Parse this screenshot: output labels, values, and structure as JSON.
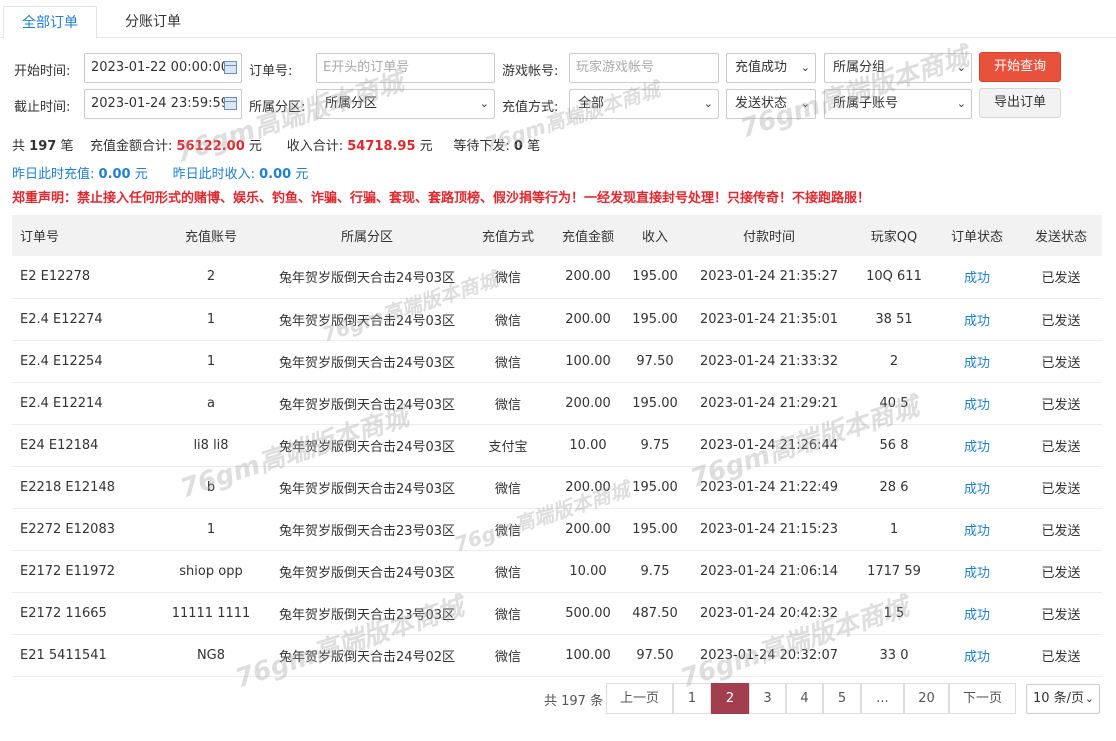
{
  "tabs": [
    {
      "label": "全部订单"
    },
    {
      "label": "分账订单"
    }
  ],
  "filters": {
    "start_time": {
      "label": "开始时间:",
      "value": "2023-01-22 00:00:00"
    },
    "end_time": {
      "label": "截止时间:",
      "value": "2023-01-24 23:59:59"
    },
    "order_no": {
      "label": "订单号:",
      "placeholder": "E开头的订单号"
    },
    "game_account": {
      "label": "游戏帐号:",
      "placeholder": "玩家游戏帐号"
    },
    "partition": {
      "label": "所属分区:",
      "value": "所属分区"
    },
    "pay_method": {
      "label": "充值方式:",
      "value": "全部"
    },
    "recharge_status": {
      "value": "充值成功"
    },
    "group": {
      "value": "所属分组"
    },
    "send_status": {
      "value": "发送状态"
    },
    "sub_account": {
      "value": "所属子账号"
    },
    "query_button": "开始查询",
    "export_button": "导出订单"
  },
  "stats": {
    "total_prefix": "共",
    "total_count": "197",
    "total_suffix": "笔",
    "recharge_label": "充值金额合计:",
    "recharge_value": "56122.00",
    "recharge_unit": "元",
    "income_label": "收入合计:",
    "income_value": "54718.95",
    "income_unit": "元",
    "pending_label": "等待下发:",
    "pending_value": "0",
    "pending_unit": "笔"
  },
  "yesterday": {
    "recharge_label": "昨日此时充值:",
    "recharge_value": "0.00",
    "recharge_unit": "元",
    "income_label": "昨日此时收入:",
    "income_value": "0.00",
    "income_unit": "元"
  },
  "notice": "郑重声明：禁止接入任何形式的赌博、娱乐、钓鱼、诈骗、行骗、套现、套路顶榜、假沙捐等行为！一经发现直接封号处理！只接传奇！不接跑路服！",
  "table": {
    "headers": [
      "订单号",
      "充值账号",
      "所属分区",
      "充值方式",
      "充值金额",
      "收入",
      "付款时间",
      "玩家QQ",
      "订单状态",
      "发送状态"
    ],
    "rows": [
      [
        "E2  E12278",
        "2",
        "兔年贺岁版倒天合击24号03区",
        "微信",
        "200.00",
        "195.00",
        "2023-01-24 21:35:27",
        "10Q   611",
        "成功",
        "已发送"
      ],
      [
        "E2.4  E12274",
        "1",
        "兔年贺岁版倒天合击24号03区",
        "微信",
        "200.00",
        "195.00",
        "2023-01-24 21:35:01",
        "38   51",
        "成功",
        "已发送"
      ],
      [
        "E2.4  E12254",
        "1",
        "兔年贺岁版倒天合击24号03区",
        "微信",
        "100.00",
        "97.50",
        "2023-01-24 21:33:32",
        "2",
        "成功",
        "已发送"
      ],
      [
        "E2.4  E12214",
        "a",
        "兔年贺岁版倒天合击24号03区",
        "微信",
        "200.00",
        "195.00",
        "2023-01-24 21:29:21",
        "40   5",
        "成功",
        "已发送"
      ],
      [
        "E24  E12184",
        "li8   li8",
        "兔年贺岁版倒天合击24号03区",
        "支付宝",
        "10.00",
        "9.75",
        "2023-01-24 21:26:44",
        "56   8",
        "成功",
        "已发送"
      ],
      [
        "E2218  E12148",
        "b",
        "兔年贺岁版倒天合击24号03区",
        "微信",
        "200.00",
        "195.00",
        "2023-01-24 21:22:49",
        "28   6",
        "成功",
        "已发送"
      ],
      [
        "E2272  E12083",
        "1",
        "兔年贺岁版倒天合击23号03区",
        "微信",
        "200.00",
        "195.00",
        "2023-01-24 21:15:23",
        "1",
        "成功",
        "已发送"
      ],
      [
        "E2172  E11972",
        "shiop   opp",
        "兔年贺岁版倒天合击24号03区",
        "微信",
        "10.00",
        "9.75",
        "2023-01-24 21:06:14",
        "1717   59",
        "成功",
        "已发送"
      ],
      [
        "E2172  11665",
        "11111   1111",
        "兔年贺岁版倒天合击23号03区",
        "微信",
        "500.00",
        "487.50",
        "2023-01-24 20:42:32",
        "1   5",
        "成功",
        "已发送"
      ],
      [
        "E21   5411541",
        "NG8",
        "兔年贺岁版倒天合击24号02区",
        "微信",
        "100.00",
        "97.50",
        "2023-01-24 20:32:07",
        "33   0",
        "成功",
        "已发送"
      ]
    ]
  },
  "pagination": {
    "total": "共 197 条",
    "prev": "上一页",
    "pages": [
      "1",
      "2",
      "3",
      "4",
      "5",
      "...",
      "20"
    ],
    "next": "下一页",
    "page_size": "10 条/页"
  },
  "watermark": "76gm高端版本商城",
  "colors": {
    "accent": "#1f7fd6",
    "danger": "#e0282e",
    "query_button": "#e8523c",
    "current_page": "#a33e4e"
  }
}
